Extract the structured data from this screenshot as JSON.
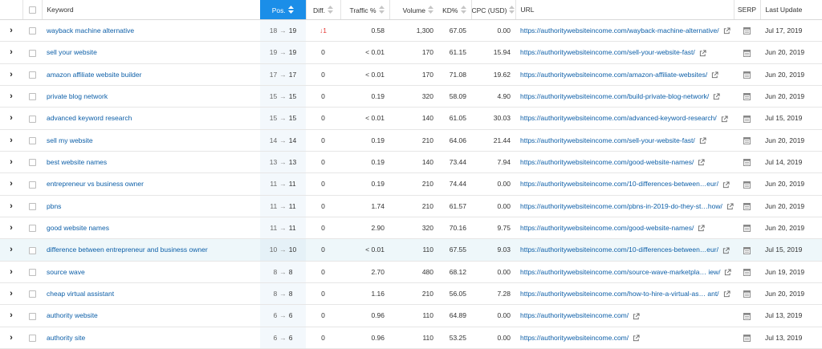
{
  "colors": {
    "accent": "#1b8ee8",
    "link": "#0d5fa8",
    "negative": "#e53935"
  },
  "columns": {
    "keyword": "Keyword",
    "pos": "Pos.",
    "diff": "Diff.",
    "traffic": "Traffic %",
    "volume": "Volume",
    "kd": "KD%",
    "cpc": "CPC (USD)",
    "url": "URL",
    "serp": "SERP",
    "last_update": "Last Update"
  },
  "rows": [
    {
      "keyword": "wayback machine alternative",
      "pos_prev": "18",
      "pos": "19",
      "diff": "1",
      "diff_dir": "down",
      "traffic": "0.58",
      "volume": "1,300",
      "kd": "67.05",
      "cpc": "0.00",
      "url": "https://authoritywebsiteincome.com/wayback-machine-alternative/",
      "date": "Jul 17, 2019"
    },
    {
      "keyword": "sell your website",
      "pos_prev": "19",
      "pos": "19",
      "diff": "0",
      "traffic": "< 0.01",
      "volume": "170",
      "kd": "61.15",
      "cpc": "15.94",
      "url": "https://authoritywebsiteincome.com/sell-your-website-fast/",
      "date": "Jun 20, 2019"
    },
    {
      "keyword": "amazon affiliate website builder",
      "pos_prev": "17",
      "pos": "17",
      "diff": "0",
      "traffic": "< 0.01",
      "volume": "170",
      "kd": "71.08",
      "cpc": "19.62",
      "url": "https://authoritywebsiteincome.com/amazon-affiliate-websites/",
      "date": "Jun 20, 2019"
    },
    {
      "keyword": "private blog network",
      "pos_prev": "15",
      "pos": "15",
      "diff": "0",
      "traffic": "0.19",
      "volume": "320",
      "kd": "58.09",
      "cpc": "4.90",
      "url": "https://authoritywebsiteincome.com/build-private-blog-network/",
      "date": "Jun 20, 2019"
    },
    {
      "keyword": "advanced keyword research",
      "pos_prev": "15",
      "pos": "15",
      "diff": "0",
      "traffic": "< 0.01",
      "volume": "140",
      "kd": "61.05",
      "cpc": "30.03",
      "url": "https://authoritywebsiteincome.com/advanced-keyword-research/",
      "date": "Jul 15, 2019"
    },
    {
      "keyword": "sell my website",
      "pos_prev": "14",
      "pos": "14",
      "diff": "0",
      "traffic": "0.19",
      "volume": "210",
      "kd": "64.06",
      "cpc": "21.44",
      "url": "https://authoritywebsiteincome.com/sell-your-website-fast/",
      "date": "Jun 20, 2019"
    },
    {
      "keyword": "best website names",
      "pos_prev": "13",
      "pos": "13",
      "diff": "0",
      "traffic": "0.19",
      "volume": "140",
      "kd": "73.44",
      "cpc": "7.94",
      "url": "https://authoritywebsiteincome.com/good-website-names/",
      "date": "Jul 14, 2019"
    },
    {
      "keyword": "entrepreneur vs business owner",
      "pos_prev": "11",
      "pos": "11",
      "diff": "0",
      "traffic": "0.19",
      "volume": "210",
      "kd": "74.44",
      "cpc": "0.00",
      "url": "https://authoritywebsiteincome.com/10-differences-between…eur/",
      "date": "Jun 20, 2019"
    },
    {
      "keyword": "pbns",
      "pos_prev": "11",
      "pos": "11",
      "diff": "0",
      "traffic": "1.74",
      "volume": "210",
      "kd": "61.57",
      "cpc": "0.00",
      "url": "https://authoritywebsiteincome.com/pbns-in-2019-do-they-st…how/",
      "date": "Jun 20, 2019"
    },
    {
      "keyword": "good website names",
      "pos_prev": "11",
      "pos": "11",
      "diff": "0",
      "traffic": "2.90",
      "volume": "320",
      "kd": "70.16",
      "cpc": "9.75",
      "url": "https://authoritywebsiteincome.com/good-website-names/",
      "date": "Jun 20, 2019"
    },
    {
      "keyword": "difference between entrepreneur and business owner",
      "pos_prev": "10",
      "pos": "10",
      "diff": "0",
      "traffic": "< 0.01",
      "volume": "110",
      "kd": "67.55",
      "cpc": "9.03",
      "url": "https://authoritywebsiteincome.com/10-differences-between…eur/",
      "date": "Jul 15, 2019",
      "highlight": true
    },
    {
      "keyword": "source wave",
      "pos_prev": "8",
      "pos": "8",
      "diff": "0",
      "traffic": "2.70",
      "volume": "480",
      "kd": "68.12",
      "cpc": "0.00",
      "url": "https://authoritywebsiteincome.com/source-wave-marketpla… iew/",
      "date": "Jun 19, 2019"
    },
    {
      "keyword": "cheap virtual assistant",
      "pos_prev": "8",
      "pos": "8",
      "diff": "0",
      "traffic": "1.16",
      "volume": "210",
      "kd": "56.05",
      "cpc": "7.28",
      "url": "https://authoritywebsiteincome.com/how-to-hire-a-virtual-as… ant/",
      "date": "Jun 20, 2019"
    },
    {
      "keyword": "authority website",
      "pos_prev": "6",
      "pos": "6",
      "diff": "0",
      "traffic": "0.96",
      "volume": "110",
      "kd": "64.89",
      "cpc": "0.00",
      "url": "https://authoritywebsiteincome.com/",
      "date": "Jul 13, 2019"
    },
    {
      "keyword": "authority site",
      "pos_prev": "6",
      "pos": "6",
      "diff": "0",
      "traffic": "0.96",
      "volume": "110",
      "kd": "53.25",
      "cpc": "0.00",
      "url": "https://authoritywebsiteincome.com/",
      "date": "Jul 13, 2019"
    }
  ]
}
